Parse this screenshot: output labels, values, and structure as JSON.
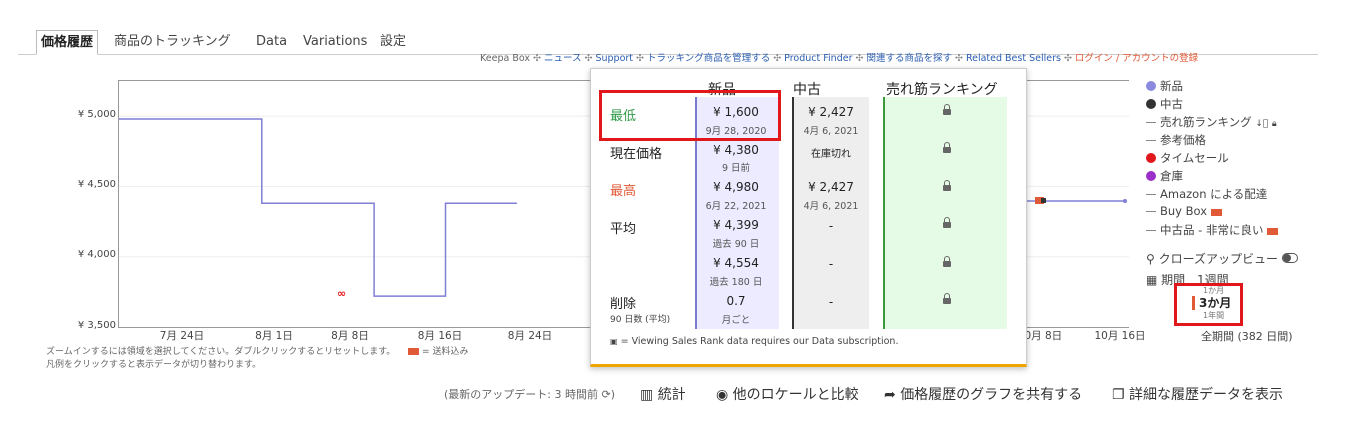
{
  "tabs": [
    "価格履歴",
    "商品のトラッキング",
    "Data",
    "Variations",
    "設定"
  ],
  "toplinks": {
    "keepa_box": "Keepa Box",
    "news": "ニュース",
    "support": "Support",
    "manage": "トラッキング商品を管理する",
    "finder": "Product Finder",
    "related": "関連する商品を探す",
    "best": "Related Best Sellers",
    "login": "ログイン / アカウントの登録"
  },
  "chart": {
    "y_ticks": [
      "¥ 5,000",
      "¥ 4,500",
      "¥ 4,000",
      "¥ 3,500"
    ],
    "x_ticks": [
      "7月 24日",
      "8月 1日",
      "8月 8日",
      "8月 16日",
      "8月 24日",
      "10月 8日",
      "10月 16日"
    ],
    "line_color": "#7f7fd6",
    "lightning_color": "#e0171b"
  },
  "chart_data": {
    "type": "line",
    "ylim": [
      3500,
      5250
    ],
    "x_range": [
      "2020-07-16",
      "2020-10-23"
    ],
    "series": [
      {
        "name": "新品",
        "points": [
          {
            "x": "2020-07-16",
            "y": 4980
          },
          {
            "x": "2020-07-30",
            "y": 4980
          },
          {
            "x": "2020-07-30",
            "y": 4380
          },
          {
            "x": "2020-08-10",
            "y": 4380
          },
          {
            "x": "2020-08-10",
            "y": 3720
          },
          {
            "x": "2020-08-17",
            "y": 3720
          },
          {
            "x": "2020-08-17",
            "y": 4380
          },
          {
            "x": "2020-08-24",
            "y": 4380
          }
        ]
      }
    ]
  },
  "hints": {
    "zoom": "ズームインするには領域を選択してください。ダブルクリックするとリセットします。",
    "shipping": "= 送料込み",
    "legend": "凡例をクリックすると表示データが切り替わります。"
  },
  "legend": {
    "items": [
      {
        "label": "新品",
        "kind": "dot",
        "color": "#8a8adf"
      },
      {
        "label": "中古",
        "kind": "dot",
        "color": "#333333"
      },
      {
        "label": "売れ筋ランキング",
        "kind": "dash",
        "color": "#888888"
      },
      {
        "label": "参考価格",
        "kind": "dash",
        "color": "#888888"
      },
      {
        "label": "タイムセール",
        "kind": "dot",
        "color": "#e0171b"
      },
      {
        "label": "倉庫",
        "kind": "dot",
        "color": "#9b30c9"
      },
      {
        "label": "Amazon による配達",
        "kind": "dash",
        "color": "#888888"
      },
      {
        "label": "Buy Box",
        "kind": "dash",
        "color": "#888888"
      },
      {
        "label": "中古品 - 非常に良い",
        "kind": "dash",
        "color": "#888888"
      }
    ],
    "closeup": "クローズアップビュー",
    "period_label": "期間",
    "periods": [
      "1週間",
      "1か月",
      "3か月",
      "1年間"
    ],
    "all_period": "全期間 (382 日間)"
  },
  "popup": {
    "headers": {
      "new": "新品",
      "used": "中古",
      "rank": "売れ筋ランキング"
    },
    "rows": [
      {
        "label": "最低",
        "label_color": "#2e9a47",
        "new": "¥ 1,600",
        "new_sub": "9月 28, 2020",
        "used": "¥ 2,427",
        "used_sub": "4月 6, 2021"
      },
      {
        "label": "現在価格",
        "label_color": "#222222",
        "new": "¥ 4,380",
        "new_sub": "9 日前",
        "used": "在庫切れ",
        "used_sub": ""
      },
      {
        "label": "最高",
        "label_color": "#e05a37",
        "new": "¥ 4,980",
        "new_sub": "6月 22, 2021",
        "used": "¥ 2,427",
        "used_sub": "4月 6, 2021"
      },
      {
        "label": "平均",
        "label_color": "#222222",
        "new": "¥ 4,399",
        "new_sub": "過去 90 日",
        "used": "-",
        "used_sub": ""
      },
      {
        "label": "",
        "label_color": "#222222",
        "new": "¥ 4,554",
        "new_sub": "過去 180 日",
        "used": "-",
        "used_sub": ""
      },
      {
        "label": "削除",
        "label_sub": "90 日数 (平均)",
        "label_color": "#222222",
        "new": "0.7",
        "new_sub": "月ごと",
        "used": "-",
        "used_sub": ""
      }
    ],
    "note": "= Viewing Sales Rank data requires our Data subscription."
  },
  "actions": {
    "updated": "(最新のアップデート: 3 時間前",
    "stats": "統計",
    "compare": "他のロケールと比較",
    "share": "価格履歴のグラフを共有する",
    "details": "詳細な履歴データを表示"
  }
}
